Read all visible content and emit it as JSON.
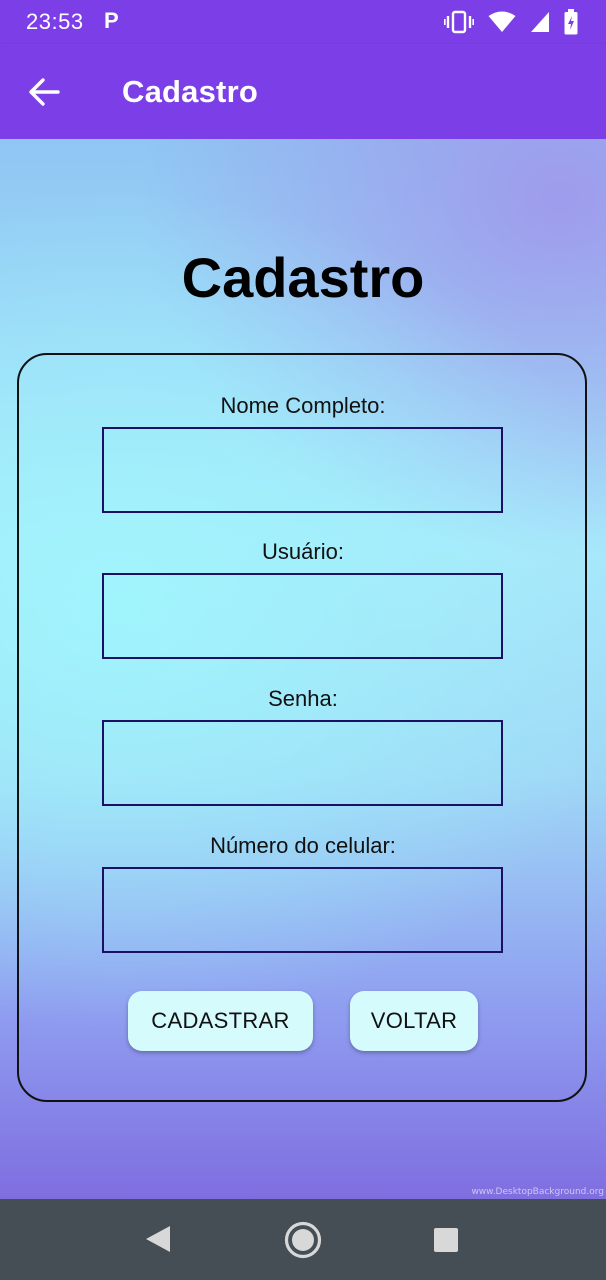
{
  "status_bar": {
    "time": "23:53",
    "notification_icon": "P",
    "icons": [
      "vibrate-icon",
      "wifi-icon",
      "signal-icon",
      "battery-icon"
    ]
  },
  "app_bar": {
    "title": "Cadastro",
    "back_icon": "arrow-left-icon"
  },
  "page": {
    "heading": "Cadastro"
  },
  "form": {
    "fields": [
      {
        "label": "Nome Completo:",
        "value": ""
      },
      {
        "label": "Usuário:",
        "value": ""
      },
      {
        "label": "Senha:",
        "value": ""
      },
      {
        "label": "Número do celular:",
        "value": ""
      }
    ],
    "buttons": {
      "register": "CADASTRAR",
      "back": "VOLTAR"
    }
  },
  "background": {
    "watermark": "www.DesktopBackground.org"
  },
  "nav_bar": {
    "icons": [
      "back-triangle-icon",
      "home-circle-icon",
      "recents-square-icon"
    ]
  },
  "colors": {
    "primary": "#7c3ee6",
    "input_border": "#1c1065",
    "button_bg": "#d6fbfd",
    "nav_bar": "#454d55"
  }
}
